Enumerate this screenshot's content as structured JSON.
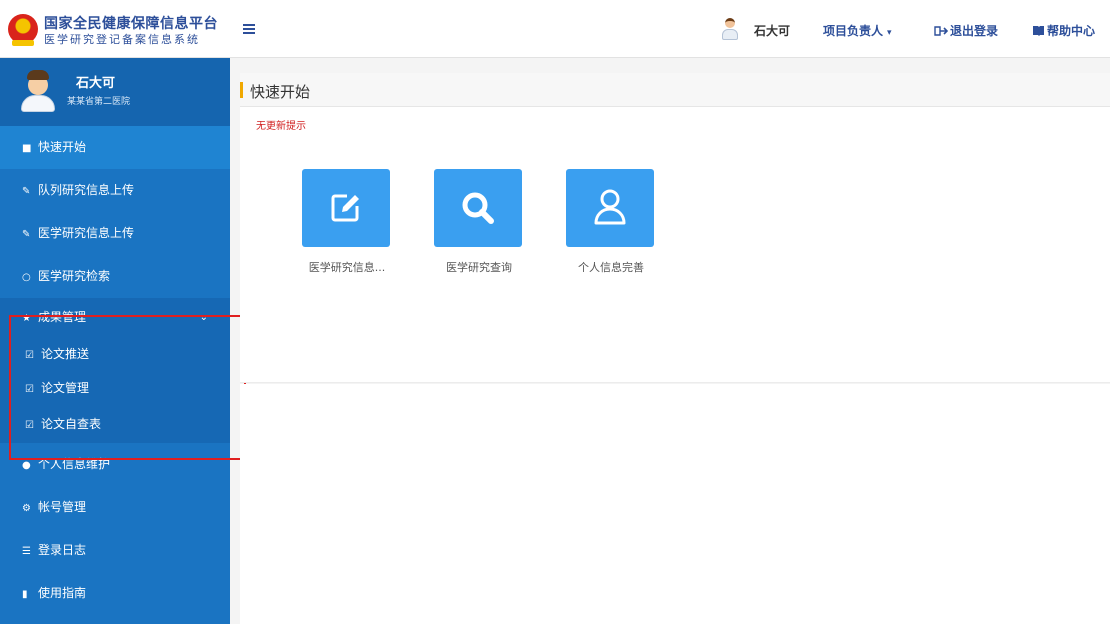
{
  "header": {
    "brand_line1": "国家全民健康保障信息平台",
    "brand_line2": "医学研究登记备案信息系统",
    "user_name": "石大可",
    "role_label": "项目负责人",
    "logout_label": "退出登录",
    "help_label": "帮助中心"
  },
  "profile": {
    "name": "石大可",
    "org": "某某省第二医院"
  },
  "sidebar": {
    "items": [
      {
        "label": "快速开始",
        "icon": "home-icon"
      },
      {
        "label": "队列研究信息上传",
        "icon": "pencil-icon"
      },
      {
        "label": "医学研究信息上传",
        "icon": "pencil-icon"
      },
      {
        "label": "医学研究检索",
        "icon": "circle-icon"
      },
      {
        "label": "成果管理",
        "icon": "star-icon"
      },
      {
        "label": "个人信息维护",
        "icon": "user-icon"
      },
      {
        "label": "帐号管理",
        "icon": "gears-icon"
      },
      {
        "label": "登录日志",
        "icon": "list-icon"
      },
      {
        "label": "使用指南",
        "icon": "book-icon"
      }
    ],
    "sub_items": [
      {
        "label": "论文推送",
        "icon": "check-square-icon"
      },
      {
        "label": "论文管理",
        "icon": "check-square-icon"
      },
      {
        "label": "论文自查表",
        "icon": "check-square-icon"
      }
    ]
  },
  "main": {
    "title": "快速开始",
    "notice": "无更新提示",
    "tiles": [
      {
        "label": "医学研究信息...",
        "icon": "edit-icon"
      },
      {
        "label": "医学研究查询",
        "icon": "search-icon"
      },
      {
        "label": "个人信息完善",
        "icon": "user-outline-icon"
      }
    ]
  },
  "colors": {
    "sidebar": "#1a74c2",
    "active": "#1f84d2",
    "tile": "#3a9ff0",
    "highlight": "#e01f1f",
    "accent": "#f0a800"
  }
}
